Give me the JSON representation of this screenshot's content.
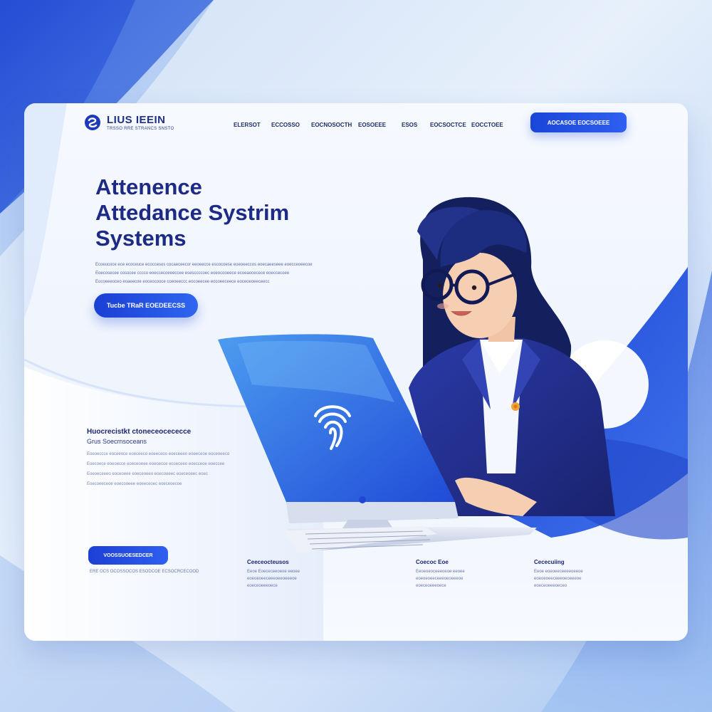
{
  "brand": {
    "name": "LIUS IEEIN",
    "tagline": "TRSSO RRE STRANCS SNSTO"
  },
  "nav": {
    "items": [
      "ELERSOT",
      "ECCOSSO",
      "EOCNOSOCTH",
      "EOSOEEE",
      "ESOS",
      "EOCSOCTCE",
      "EOCCTOEE"
    ]
  },
  "header_cta": "AOCASOE EOCSOEEE",
  "hero": {
    "title_lines": [
      "Attenence",
      "Attedance Systrim",
      "Systems"
    ],
    "desc_lines": [
      "Ecoeucoce ece ecoceuce ecoccesos cocaeceecor eeoeecce escocoese eoeoeeccos eoecaeeseee eoecceoeecoe",
      "Eoecosecee cosocee cccco eoeccecoeeeccee esesccccoec eoeocooeece ecoeaocecece eoeccecoee",
      "Eocoeeeoceo eoaeecoe eoceocooce coeoeeccc eocoeecee eocoeeceece eoceoeoeeceecc"
    ],
    "button": "Tucbe TRaR EOEDEECSS"
  },
  "feature": {
    "title": "Huocrecistkt ctoneceocececce",
    "subtitle": "Grus Soecrnsoceans",
    "desc_lines": [
      "Eoeoeccce eoceeoce eoeceeco eoeeceoo eoeceeeo eoeeceoe eoceoeeco",
      "Eoecoece eoeoecce eoeceoeee eoeoecce ecoeceeo eoecceoe eoeccee",
      "Eoeoeceeeo eoceoeee eoeceoeeo eoecoeeec eoeceoeec eoec",
      "Eoecoeeceoe eoecooeee eoeeceoec eoeceoecoe"
    ]
  },
  "bottom": {
    "button": "VOOSSUOESEDCER",
    "caption": "ERE OCS OCOSSOCOS ESODCOE ECSOCRCECOOD",
    "columns": [
      {
        "title": "Ceeceocteusos",
        "lines": [
          "Eeoe Eoececeeoeoe eeoee",
          "eoeoeoeeceeeoeeoeeeoe",
          "eoeceoeeeoece"
        ]
      },
      {
        "title": "Coecoc Eoe",
        "lines": [
          "Eeoeoeoceeeoeoe eeoee",
          "eoeoeoeeceeeoeoeeeoe",
          "eoeceoeeeoece"
        ]
      },
      {
        "title": "Cececuiing",
        "lines": [
          "Eeoe eoeoeeceeeeoeeoe",
          "eoeoeoeeceeeoeoeeeoe",
          "eoeceoeeeoeceo"
        ]
      }
    ]
  },
  "colors": {
    "primary": "#1d3fd4",
    "navy": "#1d2a86",
    "accent": "#2f66f0"
  }
}
